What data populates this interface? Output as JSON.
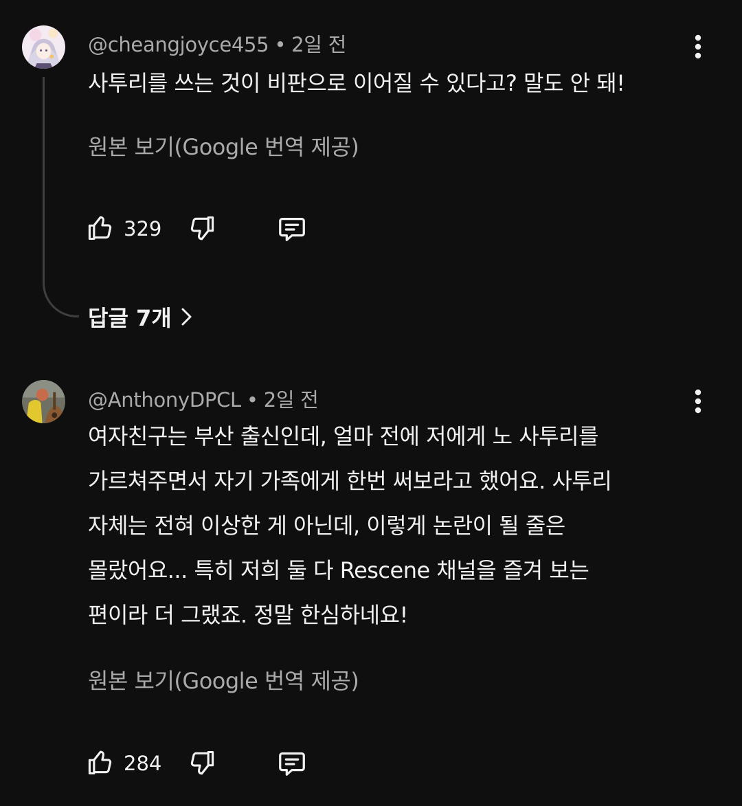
{
  "comments": [
    {
      "handle": "@cheangjoyce455",
      "time": "2일 전",
      "text_lines": [
        "사투리를 쓰는 것이 비판으로 이어질 수 있다고? 말도 안 돼!"
      ],
      "translate_label": "원본 보기(Google 번역 제공)",
      "likes": "329",
      "replies_label": "답글 7개",
      "avatar_icon": "anime-character-avatar"
    },
    {
      "handle": "@AnthonyDPCL",
      "time": "2일 전",
      "text_lines": [
        "여자친구는 부산 출신인데, 얼마 전에 저에게 노 사투리를",
        "가르쳐주면서 자기 가족에게 한번 써보라고 했어요. 사투리",
        "자체는 전혀 이상한 게 아닌데, 이렇게 논란이 될 줄은",
        "몰랐어요... 특히 저희 둘 다 Rescene 채널을 즐겨 보는",
        "편이라 더 그랬죠. 정말 한심하네요!"
      ],
      "translate_label": "원본 보기(Google 번역 제공)",
      "likes": "284",
      "avatar_icon": "guitar-avatar"
    }
  ],
  "colors": {
    "background": "#0f0f0f",
    "primary_text": "#f1f1f1",
    "secondary_text": "#aaaaaa",
    "thread_line": "#3f3f3f"
  },
  "separator": "•"
}
